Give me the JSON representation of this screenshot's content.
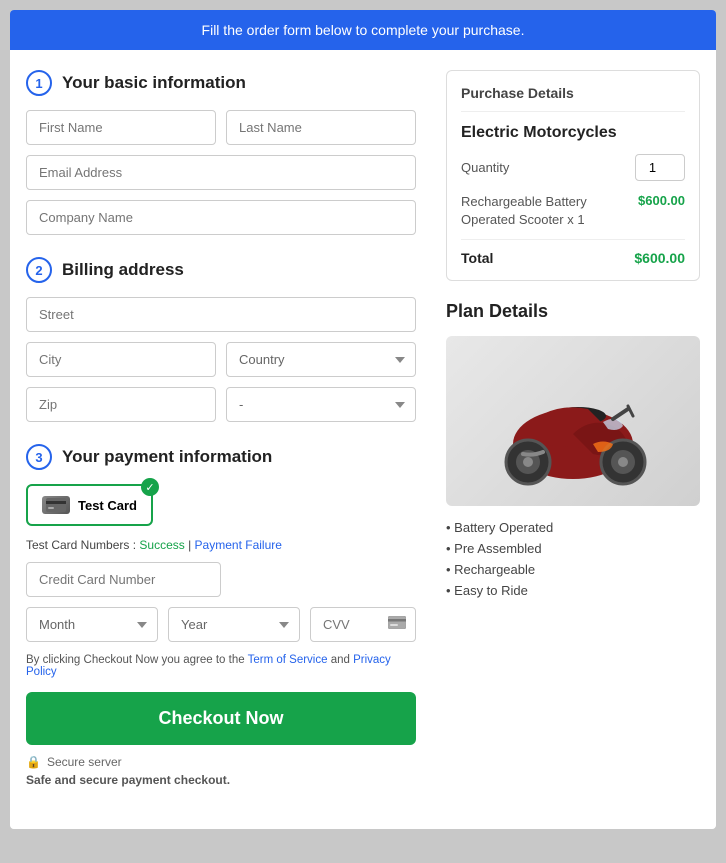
{
  "banner": {
    "text": "Fill the order form below to complete your purchase."
  },
  "steps": {
    "step1": {
      "number": "1",
      "title": "Your basic information"
    },
    "step2": {
      "number": "2",
      "title": "Billing address"
    },
    "step3": {
      "number": "3",
      "title": "Your payment information"
    }
  },
  "form": {
    "first_name_placeholder": "First Name",
    "last_name_placeholder": "Last Name",
    "email_placeholder": "Email Address",
    "company_placeholder": "Company Name",
    "street_placeholder": "Street",
    "city_placeholder": "City",
    "country_placeholder": "Country",
    "zip_placeholder": "Zip",
    "state_placeholder": "-",
    "payment_method_label": "Test Card",
    "test_card_label": "Test Card Numbers :",
    "test_success_label": "Success",
    "test_failure_label": "Payment Failure",
    "cc_number_placeholder": "Credit Card Number",
    "month_placeholder": "Month",
    "year_placeholder": "Year",
    "cvv_placeholder": "CVV",
    "tos_prefix": "By clicking Checkout Now you agree to the",
    "tos_link": "Term of Service",
    "tos_mid": "and",
    "privacy_link": "Privacy Policy",
    "checkout_label": "Checkout Now",
    "secure_label": "Secure server",
    "safe_label": "Safe and secure payment checkout."
  },
  "purchase_details": {
    "title": "Purchase Details",
    "product_name": "Electric Motorcycles",
    "quantity_label": "Quantity",
    "quantity_value": "1",
    "item_name": "Rechargeable Battery Operated Scooter x 1",
    "item_price": "$600.00",
    "total_label": "Total",
    "total_price": "$600.00"
  },
  "plan_details": {
    "title": "Plan Details",
    "features": [
      "Battery Operated",
      "Pre Assembled",
      "Rechargeable",
      "Easy to Ride"
    ]
  }
}
